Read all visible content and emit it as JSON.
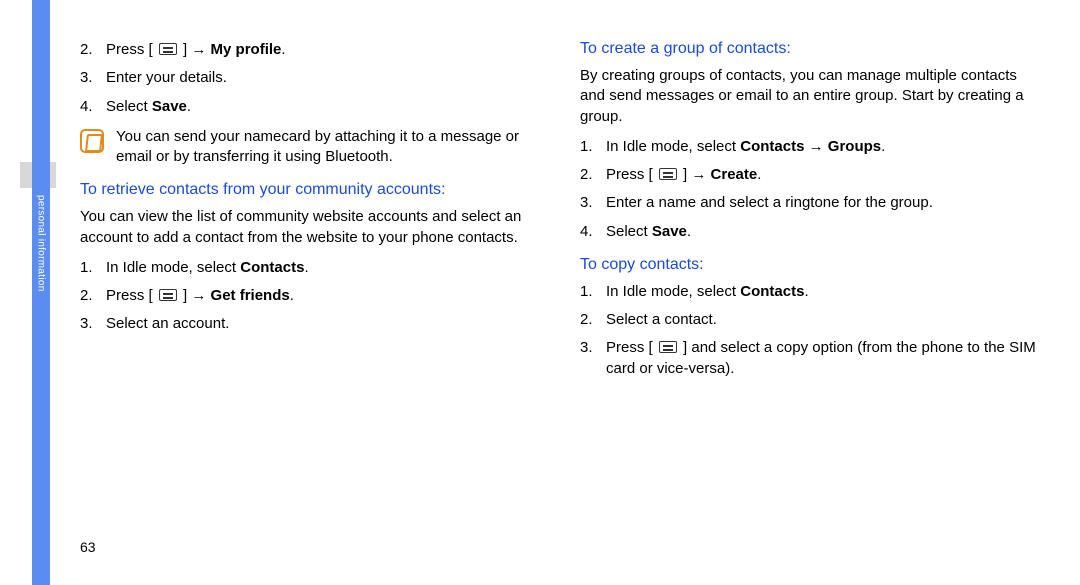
{
  "sidebar": {
    "label": "personal information"
  },
  "page_number": "63",
  "col1": {
    "steps_a": [
      {
        "num": "2.",
        "pre": "Press [ ",
        "post": " ] → ",
        "bold": "My profile",
        "end": "."
      },
      {
        "num": "3.",
        "text": "Enter your details."
      },
      {
        "num": "4.",
        "pre": "Select ",
        "bold": "Save",
        "end": "."
      }
    ],
    "note": "You can send your namecard by attaching it to a message or email or by transferring it using Bluetooth.",
    "heading_b": "To retrieve contacts from your community accounts:",
    "para_b": "You can view the list of community website accounts and select an account to add a contact from the website to your phone contacts.",
    "steps_b": [
      {
        "num": "1.",
        "pre": "In Idle mode, select ",
        "bold": "Contacts",
        "end": "."
      },
      {
        "num": "2.",
        "pre": "Press [ ",
        "post": " ] → ",
        "bold": "Get friends",
        "end": "."
      },
      {
        "num": "3.",
        "text": "Select an account."
      }
    ]
  },
  "col2": {
    "heading_a": "To create a group of contacts:",
    "para_a": "By creating groups of contacts, you can manage multiple contacts and send messages or email to an entire group. Start by creating a group.",
    "steps_a": [
      {
        "num": "1.",
        "pre": "In Idle mode, select ",
        "bold": "Contacts",
        "mid": " → ",
        "bold2": "Groups",
        "end": "."
      },
      {
        "num": "2.",
        "pre": "Press [ ",
        "post": " ] → ",
        "bold": "Create",
        "end": "."
      },
      {
        "num": "3.",
        "text": "Enter a name and select a ringtone for the group."
      },
      {
        "num": "4.",
        "pre": "Select ",
        "bold": "Save",
        "end": "."
      }
    ],
    "heading_b": "To copy contacts:",
    "steps_b": [
      {
        "num": "1.",
        "pre": "In Idle mode, select ",
        "bold": "Contacts",
        "end": "."
      },
      {
        "num": "2.",
        "text": "Select a contact."
      },
      {
        "num": "3.",
        "pre": "Press [ ",
        "post": " ] and select a copy option (from the phone to the SIM card or vice-versa)."
      }
    ]
  }
}
